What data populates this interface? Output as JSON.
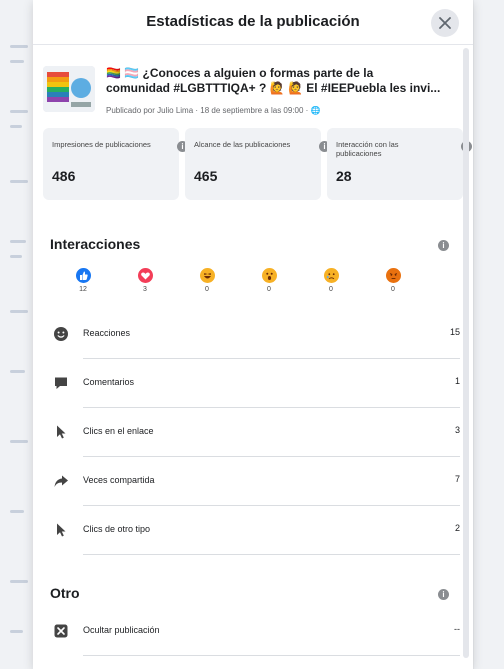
{
  "modal": {
    "title": "Estadísticas de la publicación"
  },
  "post": {
    "line1": "🏳️‍🌈 🏳️‍⚧️ ¿Conoces a alguien o formas parte de la",
    "line2": "comunidad #LGBTTTIQA+ ? 🙋 🙋 El #IEEPuebla les invi...",
    "meta": "Publicado por Julio Lima · 18 de septiembre a las 09:00 · 🌐"
  },
  "stats": [
    {
      "label": "Impresiones de publicaciones",
      "value": "486"
    },
    {
      "label": "Alcance de las publicaciones",
      "value": "465"
    },
    {
      "label": "Interacción con las publicaciones",
      "value": "28"
    }
  ],
  "interactions": {
    "title": "Interacciones",
    "reactions": [
      {
        "icon": "like-icon",
        "count": "12",
        "color": "#1877f2"
      },
      {
        "icon": "love-icon",
        "count": "3",
        "color": "#f33e58"
      },
      {
        "icon": "haha-icon",
        "count": "0",
        "color": "#f7b125"
      },
      {
        "icon": "wow-icon",
        "count": "0",
        "color": "#f7b125"
      },
      {
        "icon": "sad-icon",
        "count": "0",
        "color": "#f7b125"
      },
      {
        "icon": "angry-icon",
        "count": "0",
        "color": "#e9710f"
      }
    ],
    "rows": [
      {
        "label": "Reacciones",
        "value": "15"
      },
      {
        "label": "Comentarios",
        "value": "1"
      },
      {
        "label": "Clics en el enlace",
        "value": "3"
      },
      {
        "label": "Veces compartida",
        "value": "7"
      },
      {
        "label": "Clics de otro tipo",
        "value": "2"
      }
    ]
  },
  "other": {
    "title": "Otro",
    "rows": [
      {
        "label": "Ocultar publicación",
        "value": "--"
      }
    ]
  }
}
